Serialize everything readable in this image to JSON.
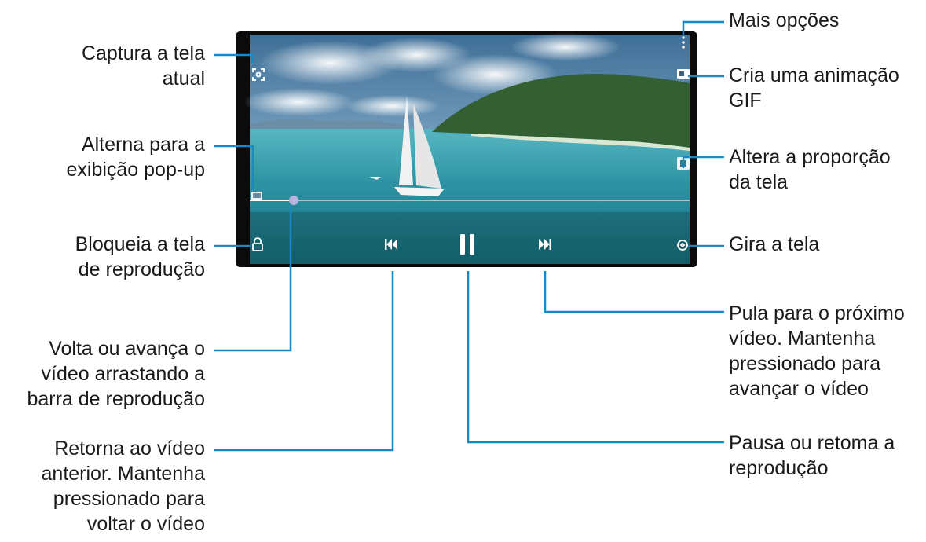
{
  "callouts": {
    "screenshot": [
      "Captura a tela",
      "atual"
    ],
    "popup": [
      "Alterna para a",
      "exibição pop-up"
    ],
    "lock": [
      "Bloqueia a tela",
      "de reprodução"
    ],
    "seek": [
      "Volta ou avança o",
      "vídeo arrastando a",
      "barra de reprodução"
    ],
    "previous": [
      "Retorna ao vídeo",
      "anterior. Mantenha",
      "pressionado para",
      "voltar o vídeo"
    ],
    "more_options": [
      "Mais opções"
    ],
    "gif": [
      "Cria uma animação",
      "GIF"
    ],
    "ratio": [
      "Altera a proporção",
      "da tela"
    ],
    "rotate": [
      "Gira a tela"
    ],
    "next": [
      "Pula para o próximo",
      "vídeo. Mantenha",
      "pressionado para",
      "avançar o vídeo"
    ],
    "pause": [
      "Pausa ou retoma a",
      "reprodução"
    ]
  },
  "player": {
    "progress": 0.1
  },
  "colors": {
    "callout_line": "#1788c8",
    "text": "#1a1a1a",
    "phone_frame": "#0b0b0b"
  },
  "icons": [
    "screenshot-icon",
    "popup-view-icon",
    "lock-icon",
    "more-options-icon",
    "gif-icon",
    "aspect-ratio-icon",
    "rotate-icon",
    "previous-icon",
    "pause-icon",
    "next-icon"
  ]
}
